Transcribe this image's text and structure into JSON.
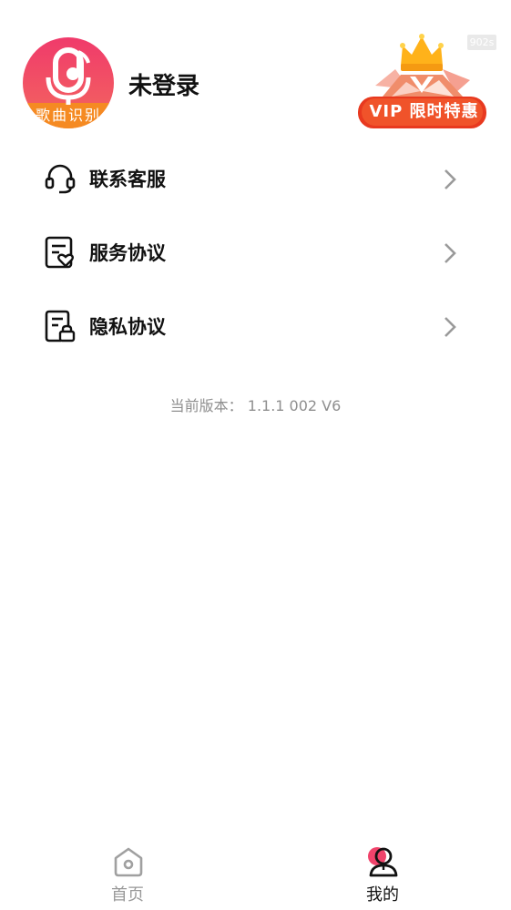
{
  "header": {
    "avatar_label": "歌曲识别",
    "username": "未登录",
    "timer_badge": "902s",
    "vip_label": "VIP 限时特惠"
  },
  "menu": {
    "items": [
      {
        "label": "联系客服",
        "icon": "headset-icon"
      },
      {
        "label": "服务协议",
        "icon": "document-heart-icon"
      },
      {
        "label": "隐私协议",
        "icon": "document-lock-icon"
      }
    ]
  },
  "version_text": "当前版本： 1.1.1 002 V6",
  "bottom_nav": {
    "items": [
      {
        "label": "首页",
        "icon": "home-icon",
        "active": false
      },
      {
        "label": "我的",
        "icon": "profile-icon",
        "active": true
      }
    ]
  },
  "colors": {
    "brand_pink": "#f0436b",
    "brand_orange": "#f58a22",
    "text_primary": "#111111",
    "text_muted": "#8f8f8f",
    "nav_inactive": "#999999",
    "chevron": "#9a9a9a"
  }
}
